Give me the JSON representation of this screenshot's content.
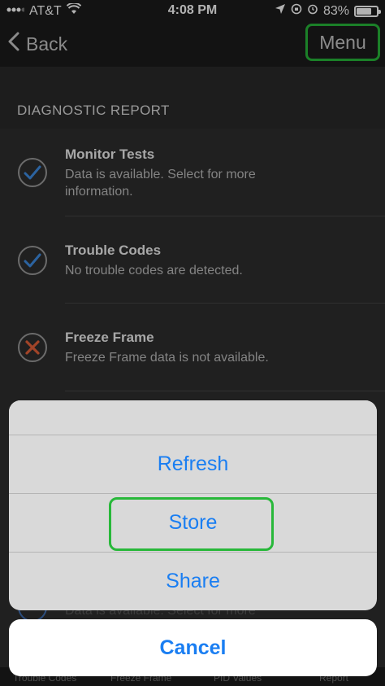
{
  "status_bar": {
    "carrier": "AT&T",
    "time": "4:08 PM",
    "battery": "83%",
    "battery_level": 0.83
  },
  "nav": {
    "back_label": "Back",
    "menu_label": "Menu"
  },
  "section": {
    "title": "DIAGNOSTIC REPORT"
  },
  "rows": [
    {
      "title": "Monitor Tests",
      "subtitle": "Data is available. Select for more information.",
      "status": "check"
    },
    {
      "title": "Trouble Codes",
      "subtitle": "No trouble codes are detected.",
      "status": "check"
    },
    {
      "title": "Freeze Frame",
      "subtitle": "Freeze Frame data is not available.",
      "status": "cross"
    }
  ],
  "behind_row": {
    "subtitle": "Data is available. Select for more"
  },
  "tabs": [
    "Trouble Codes",
    "Freeze Frame",
    "PID Values",
    "Report"
  ],
  "action_sheet": {
    "items": [
      "Refresh",
      "Store",
      "Share"
    ],
    "cancel_label": "Cancel"
  },
  "colors": {
    "accent_blue": "#1a7ef2",
    "highlight_green": "#28b83a",
    "check_blue": "#3f8ee6",
    "cross_orange": "#e8623a"
  }
}
